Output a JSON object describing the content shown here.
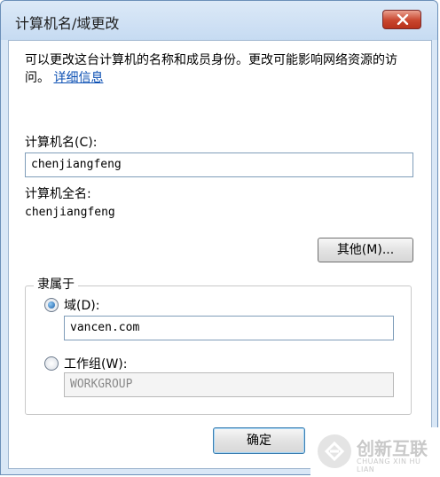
{
  "window": {
    "title": "计算机名/域更改",
    "close_icon": "close-icon"
  },
  "intro": {
    "text": "可以更改这台计算机的名称和成员身份。更改可能影响网络资源的访问。",
    "link": "详细信息"
  },
  "computer_name": {
    "label": "计算机名(C):",
    "value": "chenjiangfeng"
  },
  "full_name": {
    "label": "计算机全名:",
    "value": "chenjiangfeng"
  },
  "more_button": {
    "label": "其他(M)..."
  },
  "member_of": {
    "caption": "隶属于",
    "domain": {
      "label": "域(D):",
      "value": "vancen.com",
      "selected": true
    },
    "workgroup": {
      "label": "工作组(W):",
      "value": "WORKGROUP",
      "selected": false
    }
  },
  "buttons": {
    "ok": "确定"
  },
  "watermark": {
    "main": "创新互联",
    "sub": "CHUANG XIN HU LIAN"
  },
  "colors": {
    "link": "#0b4fb3",
    "close_button": "#c9462e",
    "frame": "#d9e7f6"
  }
}
